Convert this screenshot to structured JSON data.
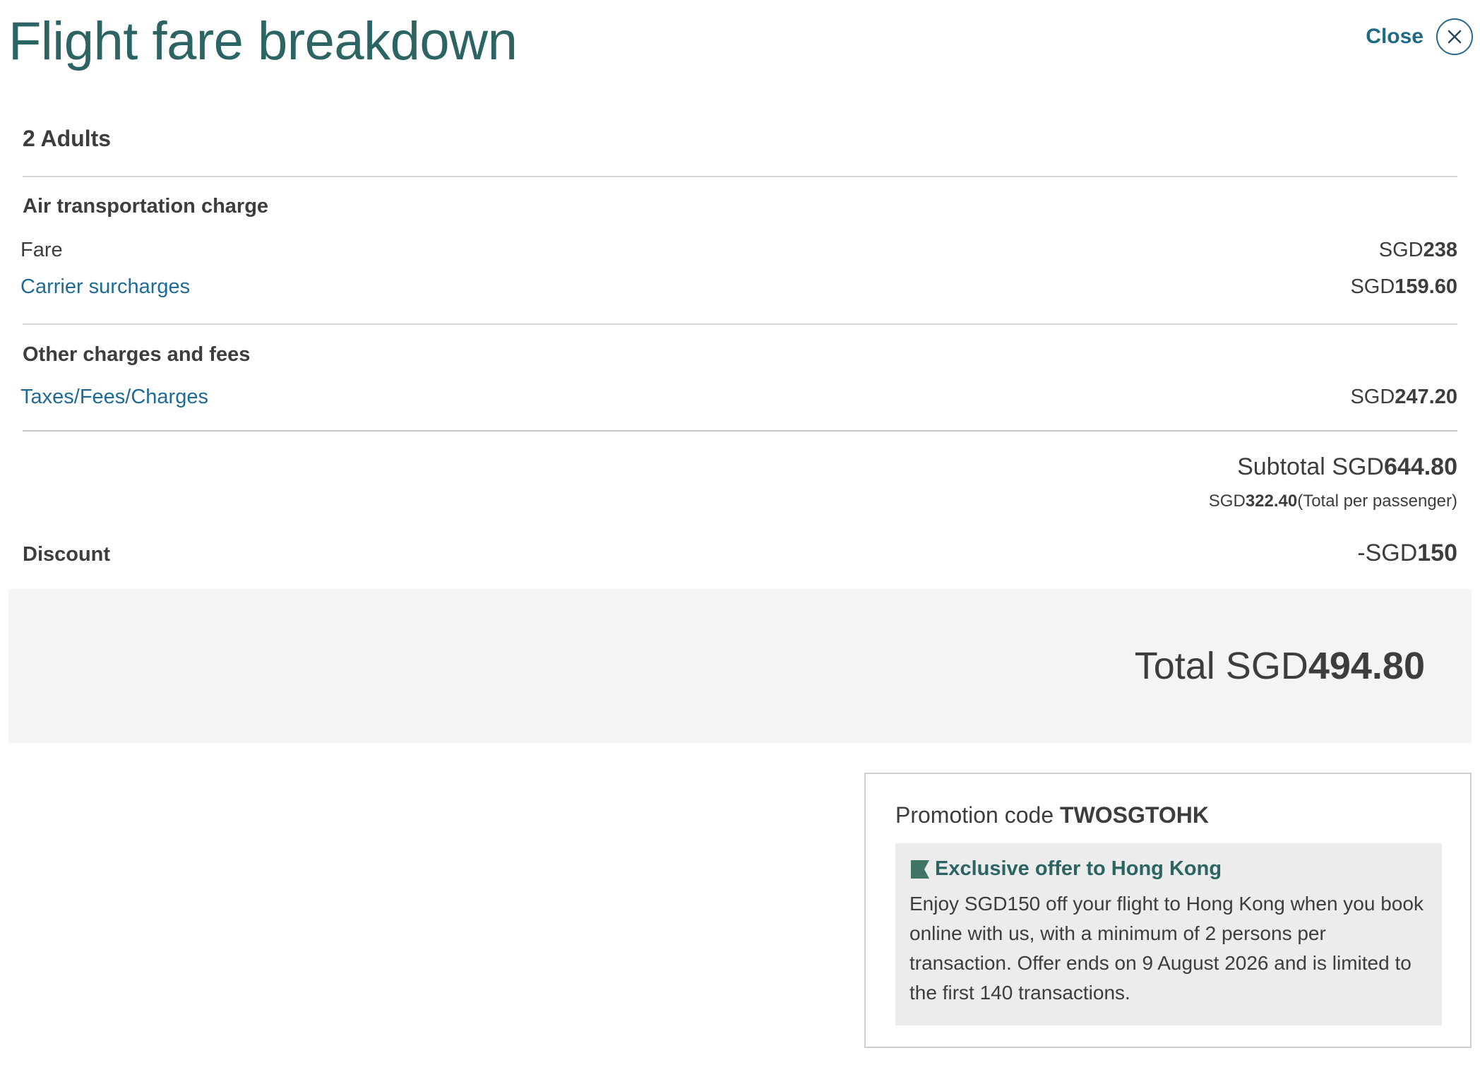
{
  "header": {
    "title": "Flight fare breakdown",
    "close_label": "Close"
  },
  "passengers": "2 Adults",
  "air_transportation": {
    "heading": "Air transportation charge",
    "fare": {
      "label": "Fare",
      "currency": "SGD",
      "amount": "238"
    },
    "carrier_surcharges": {
      "label": "Carrier surcharges",
      "currency": "SGD",
      "amount": "159.60"
    }
  },
  "other_charges": {
    "heading": "Other charges and fees",
    "taxes": {
      "label": "Taxes/Fees/Charges",
      "currency": "SGD",
      "amount": "247.20"
    }
  },
  "subtotal": {
    "label": "Subtotal",
    "currency": "SGD",
    "amount": "644.80",
    "per_passenger_currency": "SGD",
    "per_passenger_amount": "322.40",
    "per_passenger_note": "(Total per passenger)"
  },
  "discount": {
    "label": "Discount",
    "currency": "-SGD",
    "amount": "150"
  },
  "total": {
    "label": "Total",
    "currency": "SGD",
    "amount": "494.80"
  },
  "promotion": {
    "label": "Promotion code",
    "code": "TWOSGTOHK",
    "offer_title": "Exclusive offer to Hong Kong",
    "offer_description": "Enjoy SGD150 off your flight to Hong Kong when you book online with us, with a minimum of 2 persons per transaction. Offer ends on 9 August 2026 and is limited to the first 140 transactions."
  },
  "colors": {
    "brand_teal": "#2b6462",
    "link_blue": "#1f6a96",
    "text": "#3d3d3d",
    "total_band": "#f4f4f4"
  },
  "icons": [
    "close-icon",
    "flag-icon"
  ]
}
